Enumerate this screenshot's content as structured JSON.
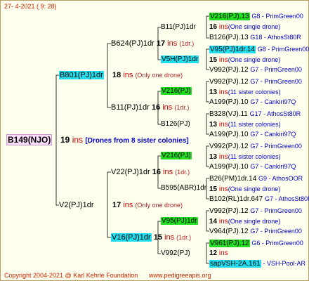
{
  "header": {
    "date": "27-  4-2021",
    "time": "(  9: 28)"
  },
  "footer": {
    "copyright": "Copyright 2004-2021 @ Karl Kehrle Foundation",
    "site": "www.pedigreeapis.org"
  },
  "root": {
    "name": "B149(NJO)",
    "ins_num": "19",
    "ins": "ins",
    "note": "[Drones from 8 sister colonies]"
  },
  "gen1": [
    {
      "name": "B801(PJ)1dr",
      "ins_num": "18",
      "ins": "ins",
      "note": "(Only one drone)"
    },
    {
      "name": "V2(PJ)1dr",
      "ins_num": "17",
      "ins": "ins",
      "note": "(Only one drone)"
    }
  ],
  "gen2": [
    {
      "name": "B624(PJ)1dr",
      "ins_num": "17",
      "ins": "ins",
      "note": "(1dr.)"
    },
    {
      "name": "B11(PJ)1dr",
      "ins_num": "16",
      "ins": "ins",
      "note": "(1dr.)"
    },
    {
      "name": "V22(PJ)1dr",
      "ins_num": "16",
      "ins": "ins",
      "note": "(1dr.)"
    },
    {
      "name": "V16(PJ)1dr",
      "ins_num": "15",
      "ins": "ins",
      "note": "(1dr.)"
    }
  ],
  "gen3": [
    {
      "name": "B11(PJ)1dr",
      "ins_num": "",
      "ins": "",
      "note": ""
    },
    {
      "name": "V5H(PJ)1dr",
      "ins_num": "",
      "ins": "",
      "note": ""
    },
    {
      "name": "V216(PJ)",
      "ins_num": "",
      "ins": "",
      "note": ""
    },
    {
      "name": "B126(PJ)",
      "ins_num": "",
      "ins": "",
      "note": ""
    },
    {
      "name": "V216(PJ)",
      "ins_num": "",
      "ins": "",
      "note": ""
    },
    {
      "name": "B595(ABR)1dr",
      "ins_num": "",
      "ins": "",
      "note": ""
    },
    {
      "name": "V95(PJ)1dr",
      "ins_num": "",
      "ins": "",
      "note": ""
    },
    {
      "name": "V992(PJ)",
      "ins_num": "",
      "ins": "",
      "note": ""
    }
  ],
  "gen4": [
    {
      "name": "V216(PJ).13",
      "src": "G8 - PrimGreen00"
    },
    {
      "ins_num": "16",
      "ins": "ins",
      "note": "(One single drone)"
    },
    {
      "name": "B126(PJ).13",
      "src": "G18 - AthosSt80R"
    },
    {
      "name": "V95(PJ)1dr.14",
      "src": "G8 - PrimGreen00"
    },
    {
      "ins_num": "15",
      "ins": "ins",
      "note": "(One single drone)"
    },
    {
      "name": "V992(PJ).12",
      "src": "G7 - PrimGreen00"
    },
    {
      "name": "V992(PJ).12",
      "src": "G7 - PrimGreen00"
    },
    {
      "ins_num": "13",
      "ins": "ins",
      "note": "(11 sister colonies)"
    },
    {
      "name": "A199(PJ).10",
      "src": "G7 - Cankiri97Q"
    },
    {
      "name": "B328(VJ).11",
      "src": "G17 - AthosSt80R"
    },
    {
      "ins_num": "13",
      "ins": "ins",
      "note": "(11 sister colonies)"
    },
    {
      "name": "A199(PJ).10",
      "src": "G7 - Cankiri97Q"
    },
    {
      "name": "V992(PJ).12",
      "src": "G7 - PrimGreen00"
    },
    {
      "ins_num": "13",
      "ins": "ins",
      "note": "(11 sister colonies)"
    },
    {
      "name": "A199(PJ).10",
      "src": "G7 - Cankiri97Q"
    },
    {
      "name": "B26(PM)1dr.14",
      "src": "G9 - AthosOOR"
    },
    {
      "ins_num": "15",
      "ins": "ins",
      "note": "(One single drone)"
    },
    {
      "name": "B102(RL)1dr.647",
      "src": "G7 - AthosSt80R"
    },
    {
      "name": "V992(PJ).12",
      "src": "G7 - PrimGreen00"
    },
    {
      "ins_num": "14",
      "ins": "ins",
      "note": "(One single drone)"
    },
    {
      "name": "V964(PJ).12",
      "src": "G7 - PrimGreen00"
    },
    {
      "name": "V961(PJ).12",
      "src": "G6 - PrimGreen00"
    },
    {
      "ins_num": "12",
      "ins": "ins",
      "note": ""
    },
    {
      "name": "sapVSH-2A.161",
      "src": "- VSH-Pool-AR"
    }
  ]
}
